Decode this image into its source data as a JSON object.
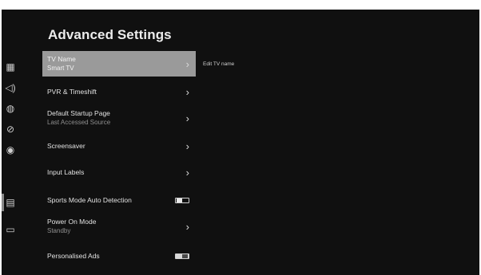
{
  "page": {
    "title": "Advanced Settings"
  },
  "rail": [
    {
      "icon": "picture-settings-icon",
      "glyph": "▦"
    },
    {
      "icon": "sound-icon",
      "glyph": "◁)"
    },
    {
      "icon": "network-globe-icon",
      "glyph": "◍"
    },
    {
      "icon": "restrictions-icon",
      "glyph": "⊘"
    },
    {
      "icon": "accessibility-icon",
      "glyph": "◉"
    },
    {
      "icon": "system-icon",
      "glyph": "▤"
    },
    {
      "icon": "support-icon",
      "glyph": "▭"
    }
  ],
  "menu": {
    "tv_name": {
      "label": "TV Name",
      "value": "Smart TV",
      "arrow": "›"
    },
    "pvr": {
      "label": "PVR & Timeshift",
      "arrow": "›"
    },
    "startup": {
      "label": "Default Startup Page",
      "value": "Last Accessed Source",
      "arrow": "›"
    },
    "screensaver": {
      "label": "Screensaver",
      "arrow": "›"
    },
    "input_labels": {
      "label": "Input Labels",
      "arrow": "›"
    },
    "sports_mode": {
      "label": "Sports Mode Auto Detection",
      "state": "off"
    },
    "power_on": {
      "label": "Power On Mode",
      "value": "Standby",
      "arrow": "›"
    },
    "personalised_ads": {
      "label": "Personalised Ads",
      "state": "on"
    }
  },
  "detail": {
    "hint": "Edit TV name"
  }
}
